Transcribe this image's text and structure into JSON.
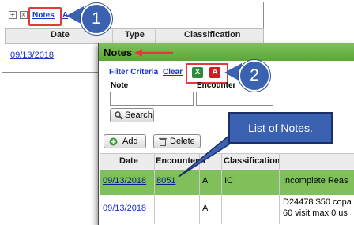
{
  "back_panel": {
    "notes_link": "Notes",
    "second_link": "A",
    "columns": [
      "Date",
      "Type",
      "Classification"
    ],
    "row_date": "09/13/2018"
  },
  "callouts": {
    "one": "1",
    "two": "2"
  },
  "main_panel": {
    "title": "Notes",
    "filter_criteria": "Filter Criteria",
    "clear": "Clear",
    "excel_icon_glyph": "X",
    "pdf_icon_glyph": "A",
    "note_label": "Note",
    "encounter_label": "Encounter",
    "note_value": "",
    "encounter_value": "",
    "search_button": "Search",
    "add_button": "Add",
    "delete_button": "Delete"
  },
  "tooltip": "List of Notes.",
  "notes_table": {
    "columns": [
      "Date",
      "Encounter",
      "T",
      "Classification"
    ],
    "rows": [
      {
        "date": "09/13/2018",
        "encounter": "8051",
        "type": "A",
        "classification": "IC",
        "note": "Incomplete Reas"
      },
      {
        "date": "09/13/2018",
        "encounter": "",
        "type": "A",
        "classification": "",
        "note_line1": "D24478 $50 copa",
        "note_line2": "60 visit max 0 us"
      }
    ]
  },
  "colors": {
    "accent_green": "#7fc05a",
    "callout_blue": "#3a62b0",
    "highlight_red": "#e23a3a",
    "link_blue": "#1a33cc"
  }
}
